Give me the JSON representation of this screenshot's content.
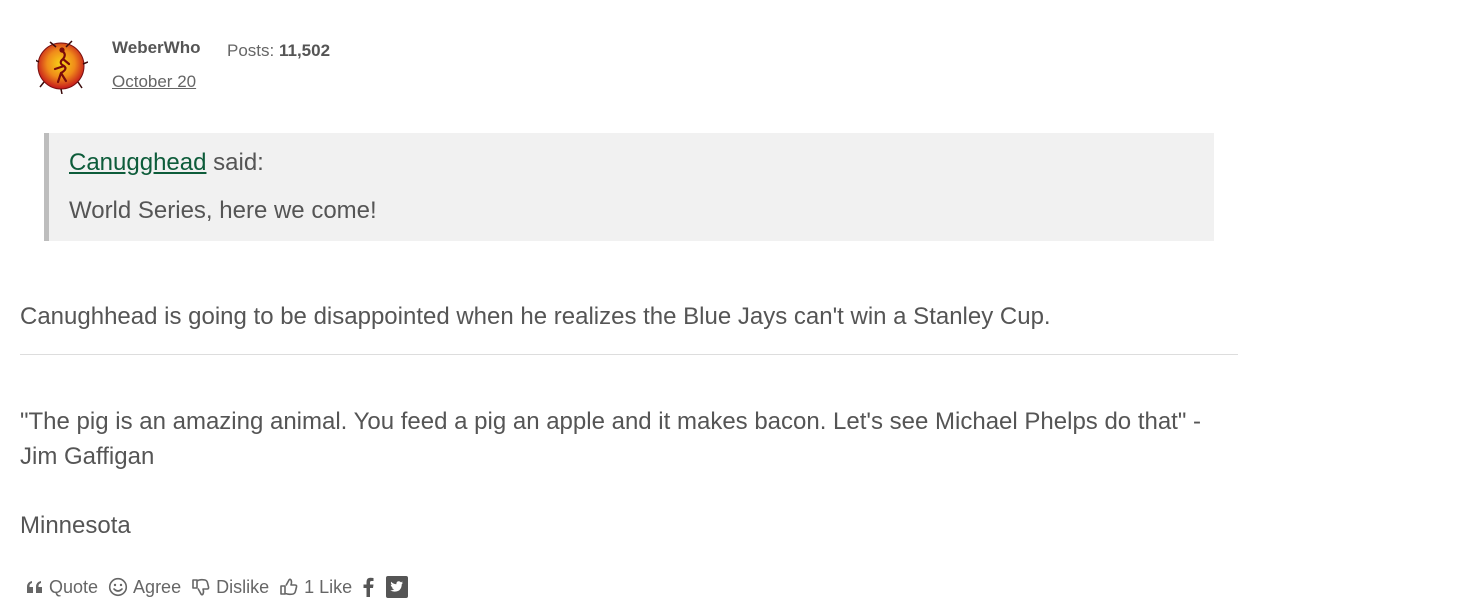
{
  "post": {
    "author": "WeberWho",
    "posts_label": "Posts:",
    "posts_count": "11,502",
    "date": "October 20",
    "quote": {
      "author": "Canugghead",
      "said": "said:",
      "text": "World Series, here we come!"
    },
    "body": "Canughhead is going to be disappointed when he realizes the Blue Jays can't win a Stanley Cup.",
    "signature": {
      "quote": "\"The pig is an amazing animal. You feed a pig an apple and it makes bacon. Let's see Michael Phelps do that\" - Jim Gaffigan",
      "location": "Minnesota"
    },
    "actions": {
      "quote_label": "Quote",
      "agree_label": "Agree",
      "dislike_label": "Dislike",
      "like_count": "1",
      "like_label": "Like"
    }
  },
  "icons": {
    "avatar": "avatar-icon",
    "quote": "quote-icon",
    "agree": "smile-icon",
    "dislike": "thumbs-down-icon",
    "like": "thumbs-up-icon",
    "facebook": "facebook-icon",
    "twitter": "twitter-icon"
  },
  "colors": {
    "text": "#555555",
    "link_green": "#0d5c3a",
    "quote_bg": "#f1f1f1",
    "quote_border": "#bdbdbd",
    "divider": "#dddddd",
    "avatar_red": "#c4161c",
    "avatar_yellow": "#f7d417"
  }
}
